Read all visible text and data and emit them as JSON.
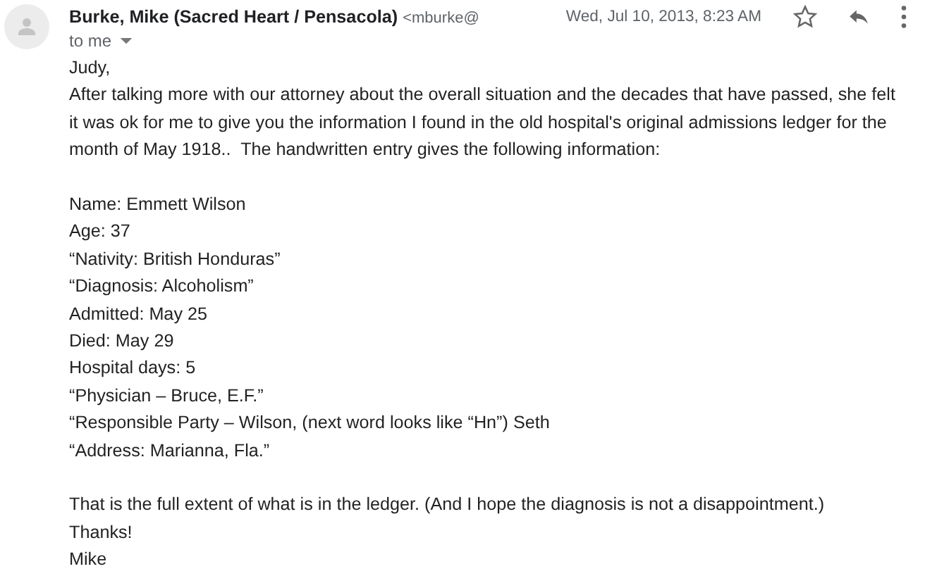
{
  "sender": {
    "name": "Burke, Mike (Sacred Heart / Pensacola)",
    "address": "<mburke@",
    "date": "Wed, Jul 10, 2013, 8:23 AM",
    "recipient": "to me"
  },
  "body": [
    {
      "kind": "line",
      "text": "Judy,"
    },
    {
      "kind": "paragraph",
      "text": "After talking more with our attorney about the overall situation and the decades that have passed, she felt it was ok for me to give you the information I found in the old hospital's original admissions ledger for the month of May 1918..  The handwritten entry gives the following information:"
    },
    {
      "kind": "gap"
    },
    {
      "kind": "line",
      "text": "Name: Emmett Wilson"
    },
    {
      "kind": "line",
      "text": "Age: 37"
    },
    {
      "kind": "line",
      "text": "“Nativity: British Honduras”"
    },
    {
      "kind": "line",
      "text": "“Diagnosis: Alcoholism”"
    },
    {
      "kind": "line",
      "text": "Admitted: May 25"
    },
    {
      "kind": "line",
      "text": "Died: May 29"
    },
    {
      "kind": "line",
      "text": "Hospital days: 5"
    },
    {
      "kind": "line",
      "text": "“Physician – Bruce, E.F.”"
    },
    {
      "kind": "line",
      "text": "“Responsible Party – Wilson, (next word looks like “Hn”) Seth"
    },
    {
      "kind": "line",
      "text": "“Address: Marianna, Fla.”"
    },
    {
      "kind": "gap"
    },
    {
      "kind": "line",
      "text": "That is the full extent of what is in the ledger. (And I hope the diagnosis is not a disappointment.)"
    },
    {
      "kind": "line",
      "text": "Thanks!"
    },
    {
      "kind": "line",
      "text": "Mike"
    }
  ]
}
